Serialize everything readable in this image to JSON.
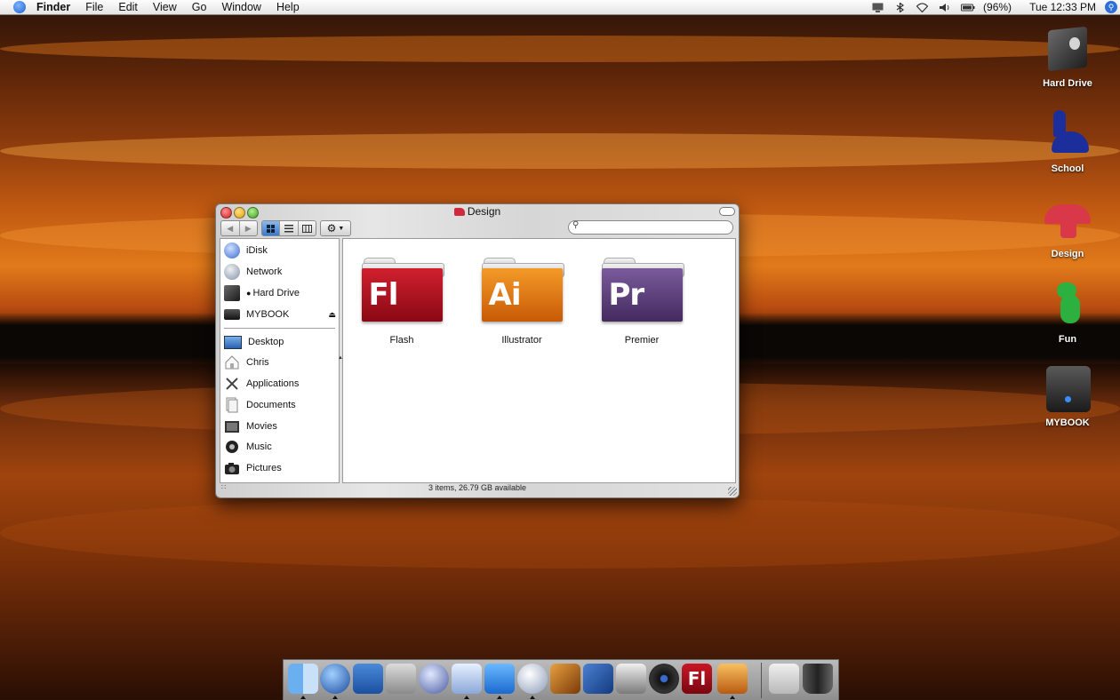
{
  "menubar": {
    "app_name": "Finder",
    "items": [
      "File",
      "Edit",
      "View",
      "Go",
      "Window",
      "Help"
    ],
    "battery": "(96%)",
    "clock": "Tue 12:33 PM",
    "status_icons": [
      "display-icon",
      "bluetooth-icon",
      "wifi-icon",
      "volume-icon",
      "battery-icon",
      "spotlight-icon"
    ]
  },
  "desktop_icons": [
    {
      "label": "Hard Drive",
      "icon": "hard-drive-icon"
    },
    {
      "label": "School",
      "icon": "blue-dinosaur-icon"
    },
    {
      "label": "Design",
      "icon": "red-dinosaur-icon"
    },
    {
      "label": "Fun",
      "icon": "green-dinosaur-icon"
    },
    {
      "label": "MYBOOK",
      "icon": "external-drive-icon"
    }
  ],
  "window": {
    "title": "Design",
    "toolbar": {
      "view_modes": [
        "icon-view",
        "list-view",
        "column-view"
      ],
      "selected_view": "icon-view",
      "search_placeholder": ""
    },
    "sidebar": {
      "devices": [
        {
          "label": "iDisk",
          "icon": "idisk-icon"
        },
        {
          "label": "Network",
          "icon": "network-icon"
        },
        {
          "label": "Hard Drive",
          "icon": "hard-drive-icon"
        },
        {
          "label": "MYBOOK",
          "icon": "external-drive-icon",
          "ejectable": true
        }
      ],
      "places": [
        {
          "label": "Desktop",
          "icon": "desktop-icon"
        },
        {
          "label": "Chris",
          "icon": "home-icon"
        },
        {
          "label": "Applications",
          "icon": "applications-icon"
        },
        {
          "label": "Documents",
          "icon": "documents-icon"
        },
        {
          "label": "Movies",
          "icon": "movies-icon"
        },
        {
          "label": "Music",
          "icon": "music-icon"
        },
        {
          "label": "Pictures",
          "icon": "pictures-icon"
        }
      ]
    },
    "items": [
      {
        "label": "Flash",
        "glyph": "Fl",
        "color": "#b0101c"
      },
      {
        "label": "Illustrator",
        "glyph": "Ai",
        "color": "#e07a10"
      },
      {
        "label": "Premier",
        "glyph": "Pr",
        "color": "#5a3a78"
      }
    ],
    "status": "3 items, 26.79 GB available"
  },
  "dock": {
    "apps": [
      "finder-icon",
      "network-globe-icon",
      "iphoto-weather-icon",
      "preview-stamp-icon",
      "xcode-icon",
      "mail-icon",
      "dreamweaver-icon",
      "itunes-icon",
      "garageband-icon",
      "app-blue-icon",
      "imovie-icon",
      "speaker-icon",
      "flash-app-icon",
      "photo-icon"
    ],
    "right_items": [
      "applications-folder-icon",
      "trash-icon"
    ],
    "flash_glyph": "Fl"
  },
  "colors": {
    "accent": "#2f6fd8",
    "flash": "#b0101c",
    "illustrator": "#e07a10",
    "premier": "#5a3a78"
  }
}
